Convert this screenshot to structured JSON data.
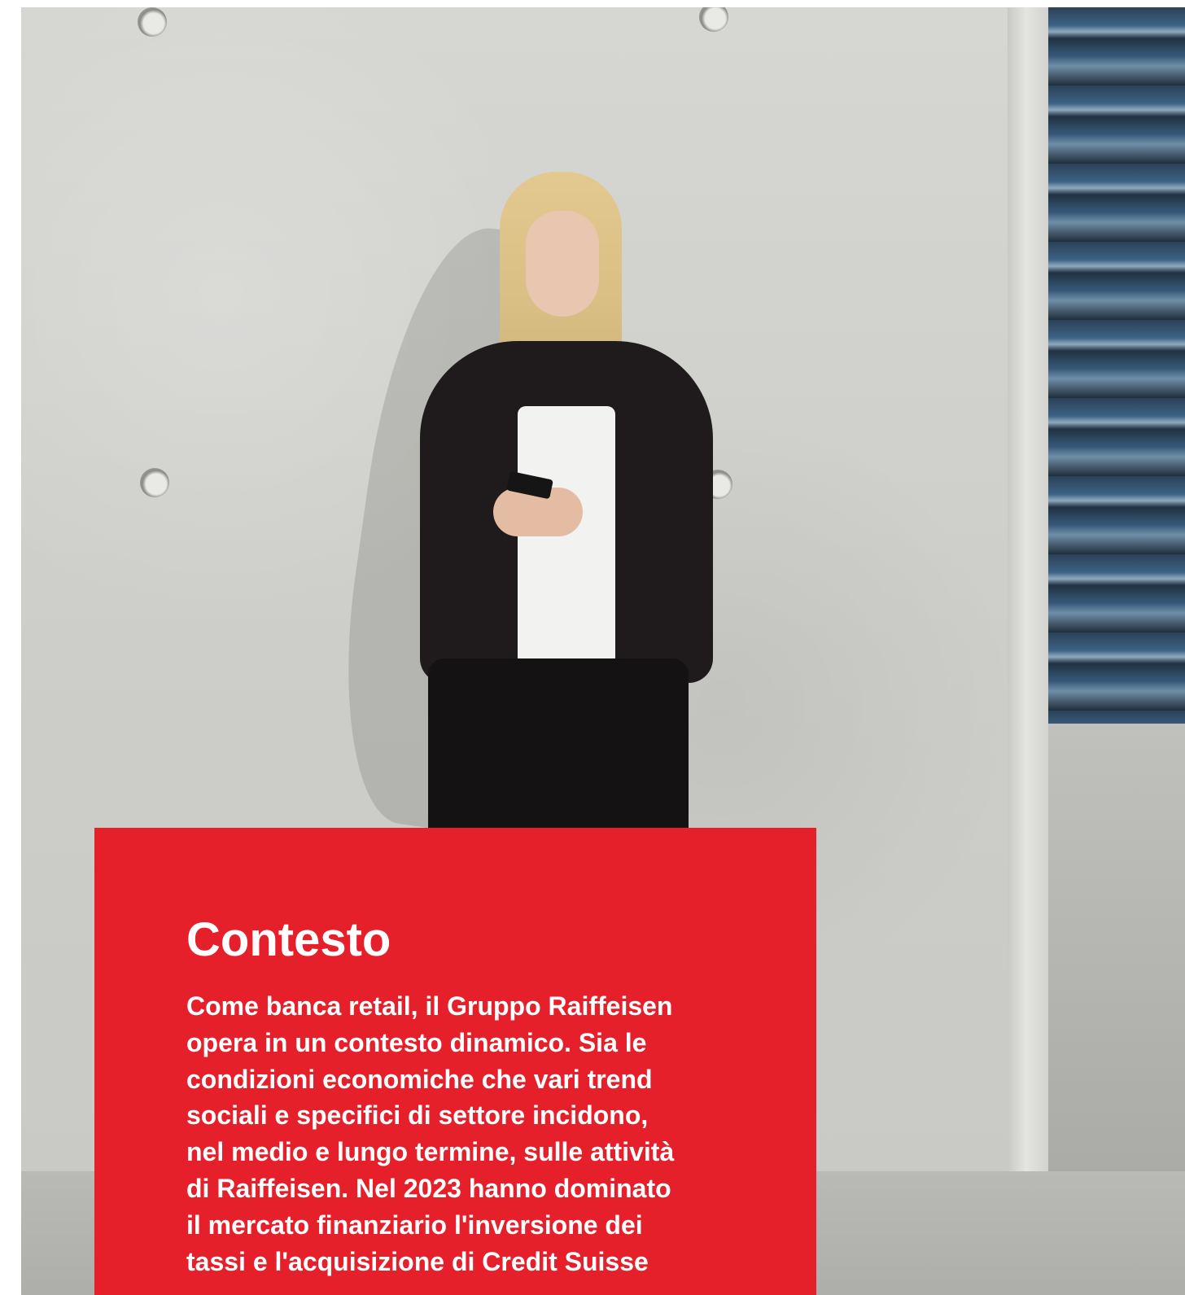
{
  "section": {
    "title": "Contesto",
    "intro_lines": [
      "Come banca retail, il Gruppo Raiffeisen",
      "opera in un contesto dinamico. Sia le",
      "condizioni economiche che vari trend",
      "sociali e specifici di settore incidono,",
      "nel medio e lungo termine, sulle attività",
      "di Raiffeisen. Nel 2023 hanno dominato",
      "il mercato finanziario l'inversione dei",
      "tassi e l'acquisizione di Credit Suisse"
    ]
  },
  "colors": {
    "accent_red": "#e5202b",
    "text_on_accent": "#ffffff"
  }
}
